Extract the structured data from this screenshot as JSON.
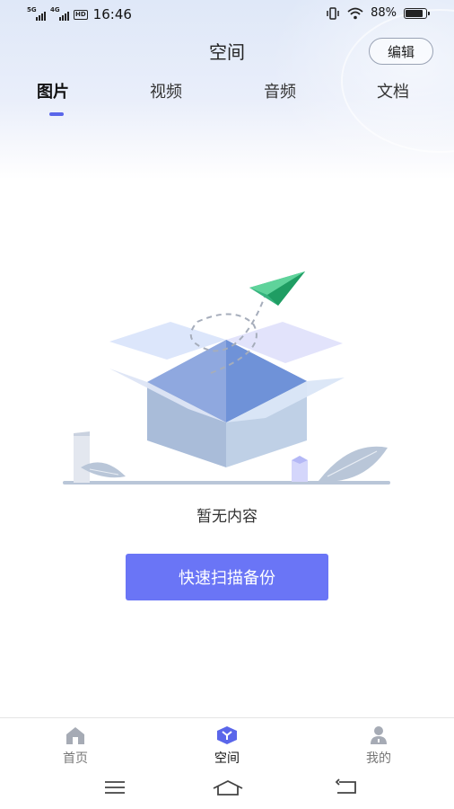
{
  "status_bar": {
    "signal1_tag": "5G",
    "signal2_tag": "4G",
    "hd_tag": "HD",
    "time": "16:46",
    "battery": "88%"
  },
  "header": {
    "title": "空间",
    "edit_label": "编辑"
  },
  "tabs": [
    {
      "label": "图片",
      "active": true
    },
    {
      "label": "视频",
      "active": false
    },
    {
      "label": "音频",
      "active": false
    },
    {
      "label": "文档",
      "active": false
    }
  ],
  "empty_state": {
    "message": "暂无内容",
    "button_label": "快速扫描备份",
    "accent_color": "#6a75f6"
  },
  "bottom_nav": [
    {
      "label": "首页",
      "icon": "home-icon",
      "active": false
    },
    {
      "label": "空间",
      "icon": "space-cube-icon",
      "active": true
    },
    {
      "label": "我的",
      "icon": "profile-icon",
      "active": false
    }
  ],
  "system_nav": [
    "menu-icon",
    "home-gesture-icon",
    "back-icon"
  ]
}
